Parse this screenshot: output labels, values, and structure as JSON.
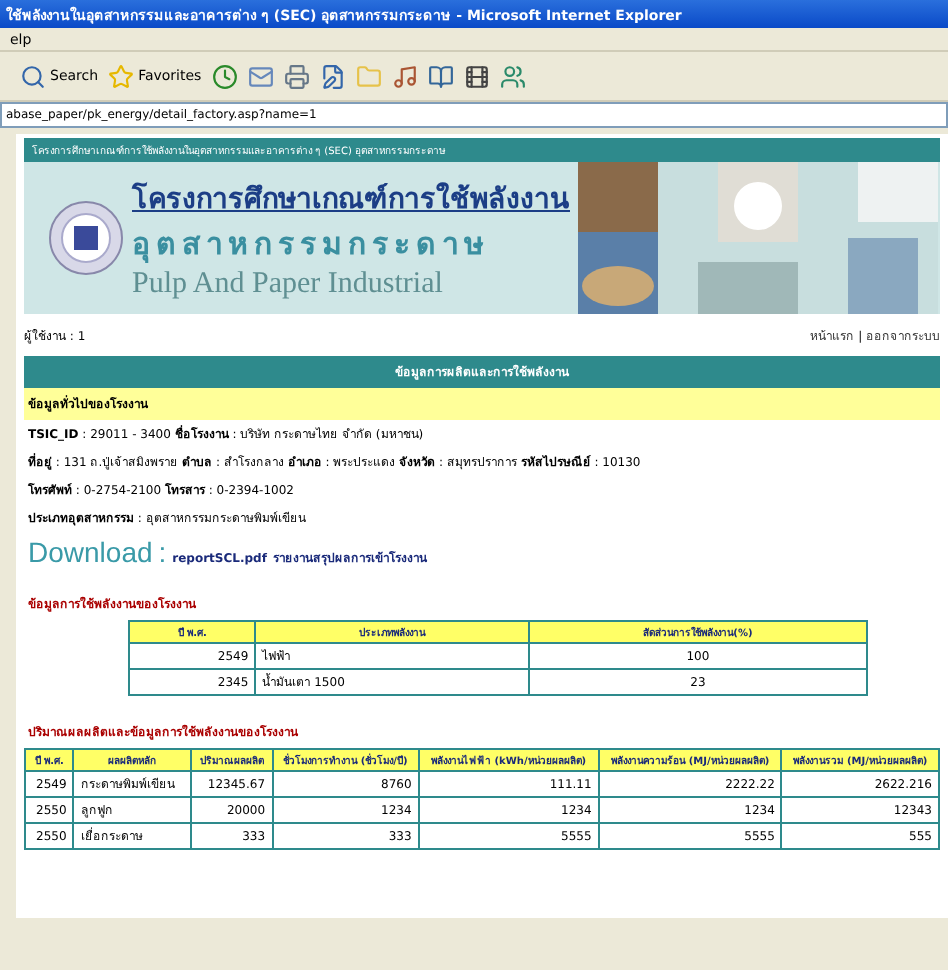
{
  "window": {
    "title": "ใช้พลังงานในอุตสาหกรรมและอาคารต่าง ๆ (SEC) อุตสาหกรรมกระดาษ - Microsoft Internet Explorer"
  },
  "menu": [
    "elp"
  ],
  "toolbar": [
    {
      "kind": "search",
      "label": "Search"
    },
    {
      "kind": "favorites",
      "label": "Favorites"
    },
    {
      "kind": "history"
    },
    {
      "kind": "mail"
    },
    {
      "kind": "print"
    },
    {
      "kind": "edit"
    },
    {
      "kind": "folder"
    },
    {
      "kind": "media"
    },
    {
      "kind": "book"
    },
    {
      "kind": "film"
    },
    {
      "kind": "messenger"
    }
  ],
  "address": "abase_paper/pk_energy/detail_factory.asp?name=1",
  "banner": {
    "top_text": "โครงการศึกษาเกณฑ์การใช้พลังงานในอุตสาหกรรมและอาคารต่าง ๆ (SEC) อุตสาหกรรมกระดาษ",
    "title": "โครงการศึกษาเกณฑ์การใช้พลังงาน",
    "subtitle": "อุตสาหกรรมกระดาษ",
    "english": "Pulp And Paper Industrial"
  },
  "user": "ผู้ใช้งาน : 1",
  "links": [
    "หน้าแรก",
    "ออกจากระบบ"
  ],
  "link_separator": "|",
  "section_title": "ข้อมูลการผลิตและการใช้พลังงาน",
  "general": {
    "heading": "ข้อมูลทั่วไปของโรงงาน",
    "separator": ":",
    "lines": [
      [
        {
          "label": "TSIC_ID",
          "value": "29011 - 3400"
        },
        {
          "label": "ชื่อโรงงาน",
          "value": "บริษัท กระดาษไทย จำกัด (มหาชน)"
        }
      ],
      [
        {
          "label": "ที่อยู่",
          "value": "131 ถ.ปู่เจ้าสมิงพราย"
        },
        {
          "label": "ตำบล",
          "value": "สำโรงกลาง"
        },
        {
          "label": "อำเภอ",
          "value": "พระประแดง"
        },
        {
          "label": "จังหวัด",
          "value": "สมุทรปราการ"
        },
        {
          "label": "รหัสไปรษณีย์",
          "value": "10130"
        }
      ],
      [
        {
          "label": "โทรศัพท์",
          "value": "0-2754-2100"
        },
        {
          "label": "โทรสาร",
          "value": "0-2394-1002"
        }
      ],
      [
        {
          "label": "ประเภทอุตสาหกรรม",
          "value": "อุตสาหกรรมกระดาษพิมพ์เขียน"
        }
      ]
    ]
  },
  "download": {
    "label": "Download",
    "separator": ":",
    "file": "reportSCL.pdf",
    "description": "รายงานสรุปผลการเข้าโรงงาน"
  },
  "energy_table": {
    "title": "ข้อมูลการใช้พลังงานของโรงงาน",
    "columns": [
      "ปี พ.ศ.",
      "ประเภทพลังงาน",
      "สัดส่วนการใช้พลังงาน(%)"
    ],
    "rows": [
      [
        "2549",
        "ไฟฟ้า",
        "100"
      ],
      [
        "2345",
        "น้ำมันเตา 1500",
        "23"
      ]
    ]
  },
  "production_table": {
    "title": "ปริมาณผลผลิตและข้อมูลการใช้พลังงานของโรงงาน",
    "columns": [
      "ปี พ.ศ.",
      "ผลผลิตหลัก",
      "ปริมาณผลผลิต",
      "ชั่วโมงการทำงาน (ชั่วโมง/ปี)",
      "พลังงานไฟฟ้า (kWh/หน่วยผลผลิต)",
      "พลังงานความร้อน (MJ/หน่วยผลผลิต)",
      "พลังงานรวม (MJ/หน่วยผลผลิต)"
    ],
    "rows": [
      [
        "2549",
        "กระดาษพิมพ์เขียน",
        "12345.67",
        "8760",
        "111.11",
        "2222.22",
        "2622.216"
      ],
      [
        "2550",
        "ลูกฟูก",
        "20000",
        "1234",
        "1234",
        "1234",
        "12343"
      ],
      [
        "2550",
        "เยื่อกระดาษ",
        "333",
        "333",
        "5555",
        "5555",
        "555"
      ]
    ]
  }
}
